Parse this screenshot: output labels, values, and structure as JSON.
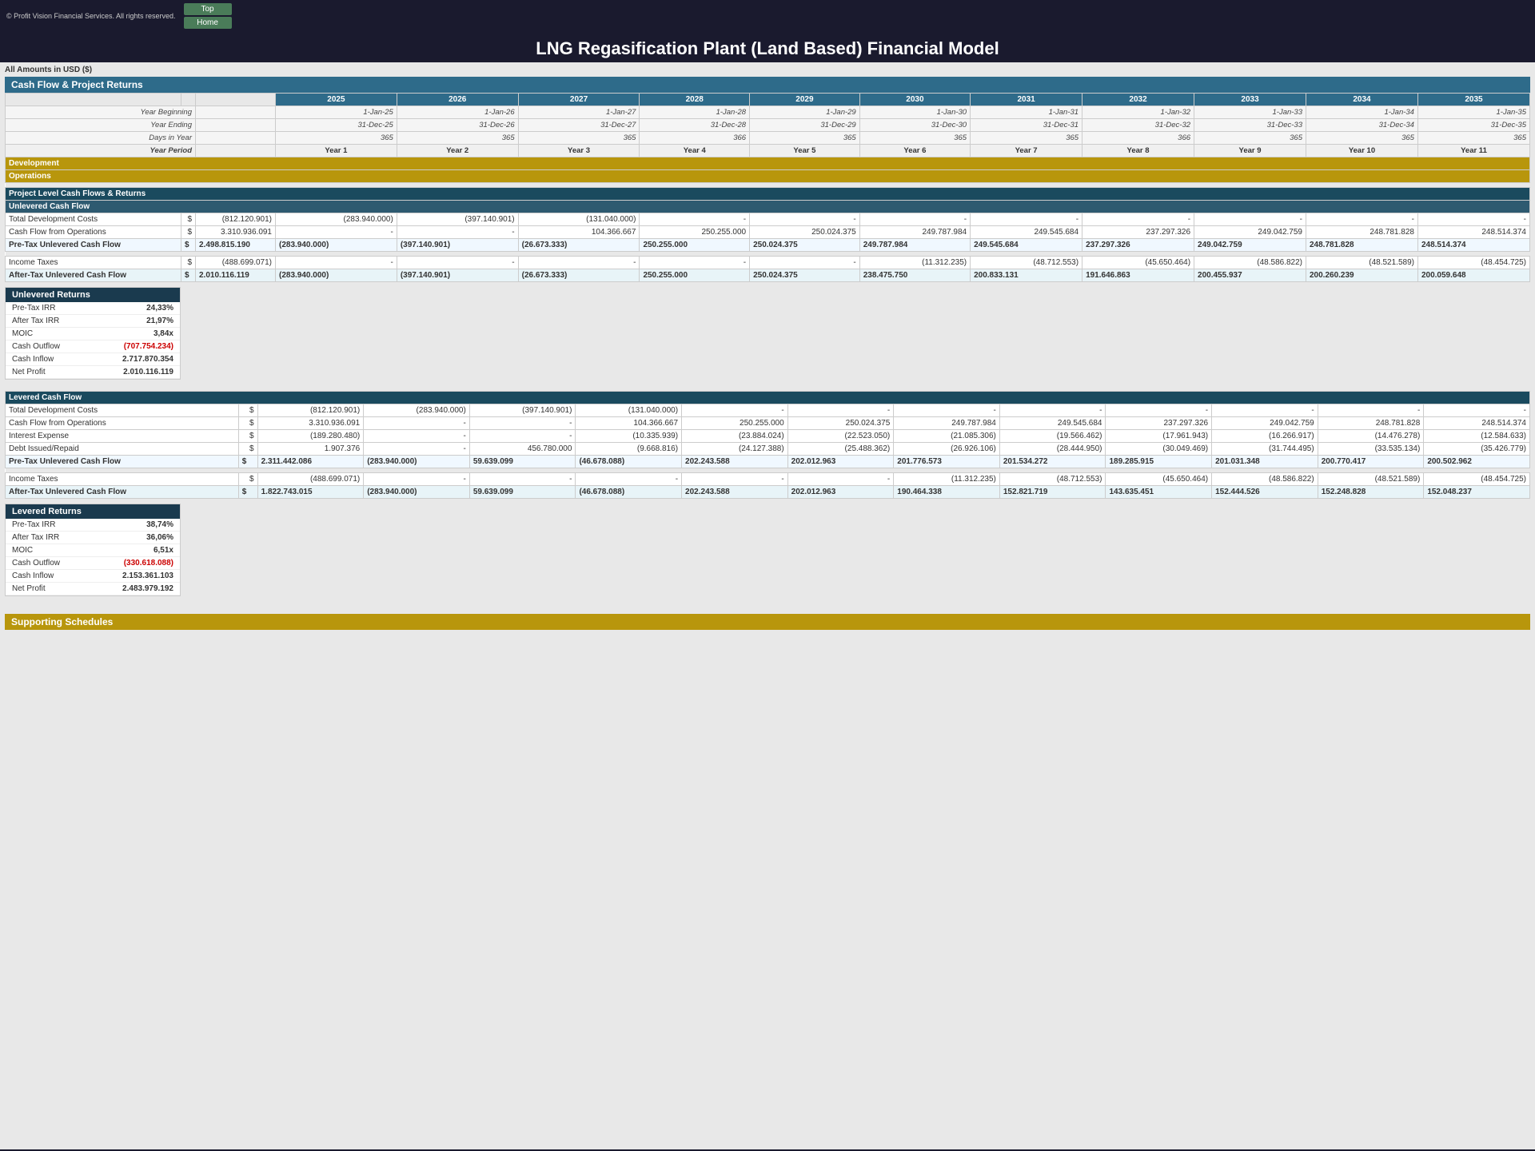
{
  "app": {
    "copyright": "© Profit Vision Financial Services. All rights reserved.",
    "top_button": "Top",
    "home_button": "Home",
    "main_title": "LNG Regasification Plant (Land Based) Financial Model"
  },
  "currency_label": "All Amounts in  USD ($)",
  "section_cashflow": "Cash Flow & Project Returns",
  "years": [
    "2025",
    "2026",
    "2027",
    "2028",
    "2029",
    "2030",
    "2031",
    "2032",
    "2033",
    "2034",
    "2035"
  ],
  "year_beginning": [
    "1-Jan-25",
    "1-Jan-26",
    "1-Jan-27",
    "1-Jan-28",
    "1-Jan-29",
    "1-Jan-30",
    "1-Jan-31",
    "1-Jan-32",
    "1-Jan-33",
    "1-Jan-34",
    "1-Jan-35"
  ],
  "year_ending": [
    "31-Dec-25",
    "31-Dec-26",
    "31-Dec-27",
    "31-Dec-28",
    "31-Dec-29",
    "31-Dec-30",
    "31-Dec-31",
    "31-Dec-32",
    "31-Dec-33",
    "31-Dec-34",
    "31-Dec-35"
  ],
  "days_in_year": [
    "365",
    "365",
    "365",
    "366",
    "365",
    "365",
    "365",
    "366",
    "365",
    "365",
    "365"
  ],
  "year_period": [
    "Year 1",
    "Year 2",
    "Year 3",
    "Year 4",
    "Year 5",
    "Year 6",
    "Year 7",
    "Year 8",
    "Year 9",
    "Year 10",
    "Year 11"
  ],
  "development_label": "Development",
  "operations_label": "Operations",
  "project_section_label": "Project Level Cash Flows & Returns",
  "unlevered_cf_label": "Unlevered Cash Flow",
  "unlevered": {
    "total_dev_costs_label": "Total Development Costs",
    "total_dev_costs_unit": "$",
    "total_dev_costs_year0": "(812.120.901)",
    "total_dev_costs": [
      "(283.940.000)",
      "(397.140.901)",
      "(131.040.000)",
      "  -",
      "  -",
      "  -",
      "  -",
      "  -",
      "  -",
      "  -",
      "  -"
    ],
    "cf_ops_label": "Cash Flow from Operations",
    "cf_ops_unit": "$",
    "cf_ops_year0": "3.310.936.091",
    "cf_ops": [
      "  -",
      "  -",
      "104.366.667",
      "250.255.000",
      "250.024.375",
      "249.787.984",
      "249.545.684",
      "237.297.326",
      "249.042.759",
      "248.781.828",
      "248.514.374"
    ],
    "pretax_label": "Pre-Tax Unlevered Cash Flow",
    "pretax_unit": "$",
    "pretax_year0": "2.498.815.190",
    "pretax": [
      "(283.940.000)",
      "(397.140.901)",
      "(26.673.333)",
      "250.255.000",
      "250.024.375",
      "249.787.984",
      "249.545.684",
      "237.297.326",
      "249.042.759",
      "248.781.828",
      "248.514.374"
    ],
    "income_tax_label": "Income Taxes",
    "income_tax_unit": "$",
    "income_tax_year0": "(488.699.071)",
    "income_tax": [
      "  -",
      "  -",
      "  -",
      "  -",
      "  -",
      "(11.312.235)",
      "(48.712.553)",
      "(45.650.464)",
      "(48.586.822)",
      "(48.521.589)",
      "(48.454.725)"
    ],
    "aftertax_label": "After-Tax Unlevered Cash Flow",
    "aftertax_unit": "$",
    "aftertax_year0": "2.010.116.119",
    "aftertax": [
      "(283.940.000)",
      "(397.140.901)",
      "(26.673.333)",
      "250.255.000",
      "250.024.375",
      "238.475.750",
      "200.833.131",
      "191.646.863",
      "200.455.937",
      "200.260.239",
      "200.059.648"
    ]
  },
  "unlevered_returns": {
    "header": "Unlevered Returns",
    "pretax_irr_label": "Pre-Tax IRR",
    "pretax_irr_val": "24,33%",
    "aftertax_irr_label": "After Tax IRR",
    "aftertax_irr_val": "21,97%",
    "moic_label": "MOIC",
    "moic_val": "3,84x",
    "cash_outflow_label": "Cash Outflow",
    "cash_outflow_val": "(707.754.234)",
    "cash_inflow_label": "Cash Inflow",
    "cash_inflow_val": "2.717.870.354",
    "net_profit_label": "Net Profit",
    "net_profit_val": "2.010.116.119"
  },
  "levered_cf_label": "Levered Cash Flow",
  "levered": {
    "total_dev_costs_label": "Total Development Costs",
    "total_dev_costs_unit": "$",
    "total_dev_costs_year0": "(812.120.901)",
    "total_dev_costs": [
      "(283.940.000)",
      "(397.140.901)",
      "(131.040.000)",
      "  -",
      "  -",
      "  -",
      "  -",
      "  -",
      "  -",
      "  -",
      "  -"
    ],
    "cf_ops_label": "Cash Flow from Operations",
    "cf_ops_unit": "$",
    "cf_ops_year0": "3.310.936.091",
    "cf_ops": [
      "  -",
      "  -",
      "104.366.667",
      "250.255.000",
      "250.024.375",
      "249.787.984",
      "249.545.684",
      "237.297.326",
      "249.042.759",
      "248.781.828",
      "248.514.374"
    ],
    "interest_label": "Interest Expense",
    "interest_unit": "$",
    "interest_year0": "(189.280.480)",
    "interest": [
      "  -",
      "  -",
      "(10.335.939)",
      "(23.884.024)",
      "(22.523.050)",
      "(21.085.306)",
      "(19.566.462)",
      "(17.961.943)",
      "(16.266.917)",
      "(14.476.278)",
      "(12.584.633)"
    ],
    "debt_label": "Debt Issued/Repaid",
    "debt_unit": "$",
    "debt_year0": "1.907.376",
    "debt": [
      "  -",
      "456.780.000",
      "(9.668.816)",
      "(24.127.388)",
      "(25.488.362)",
      "(26.926.106)",
      "(28.444.950)",
      "(30.049.469)",
      "(31.744.495)",
      "(33.535.134)",
      "(35.426.779)"
    ],
    "pretax_label": "Pre-Tax Unlevered Cash Flow",
    "pretax_unit": "$",
    "pretax_year0": "2.311.442.086",
    "pretax": [
      "(283.940.000)",
      "59.639.099",
      "(46.678.088)",
      "202.243.588",
      "202.012.963",
      "201.776.573",
      "201.534.272",
      "189.285.915",
      "201.031.348",
      "200.770.417",
      "200.502.962"
    ],
    "income_tax_label": "Income Taxes",
    "income_tax_unit": "$",
    "income_tax_year0": "(488.699.071)",
    "income_tax": [
      "  -",
      "  -",
      "  -",
      "  -",
      "  -",
      "(11.312.235)",
      "(48.712.553)",
      "(45.650.464)",
      "(48.586.822)",
      "(48.521.589)",
      "(48.454.725)"
    ],
    "aftertax_label": "After-Tax Unlevered Cash Flow",
    "aftertax_unit": "$",
    "aftertax_year0": "1.822.743.015",
    "aftertax": [
      "(283.940.000)",
      "59.639.099",
      "(46.678.088)",
      "202.243.588",
      "202.012.963",
      "190.464.338",
      "152.821.719",
      "143.635.451",
      "152.444.526",
      "152.248.828",
      "152.048.237"
    ]
  },
  "levered_returns": {
    "header": "Levered Returns",
    "pretax_irr_label": "Pre-Tax IRR",
    "pretax_irr_val": "38,74%",
    "aftertax_irr_label": "After Tax IRR",
    "aftertax_irr_val": "36,06%",
    "moic_label": "MOIC",
    "moic_val": "6,51x",
    "cash_outflow_label": "Cash Outflow",
    "cash_outflow_val": "(330.618.088)",
    "cash_inflow_label": "Cash Inflow",
    "cash_inflow_val": "2.153.361.103",
    "net_profit_label": "Net Profit",
    "net_profit_val": "2.483.979.192"
  },
  "supporting_label": "Supporting Schedules"
}
